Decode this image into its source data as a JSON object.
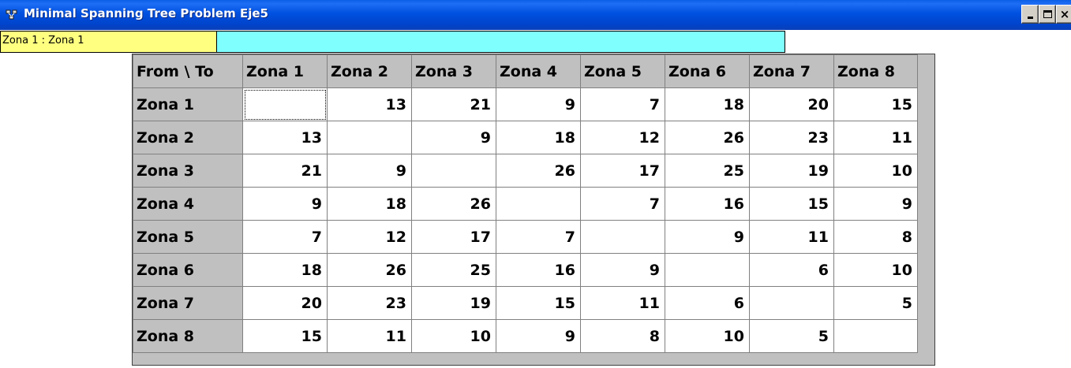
{
  "window": {
    "title": "Minimal Spanning Tree Problem Eje5",
    "icon": "app-network-icon",
    "controls": {
      "minimize": "minimize-icon",
      "maximize": "maximize-icon",
      "close": "×"
    }
  },
  "status": {
    "cell_label": "Zona 1 : Zona 1",
    "edit_value": ""
  },
  "grid": {
    "corner": "From \\ To",
    "columns": [
      "Zona 1",
      "Zona 2",
      "Zona 3",
      "Zona 4",
      "Zona 5",
      "Zona 6",
      "Zona 7",
      "Zona 8"
    ],
    "rows": [
      {
        "label": "Zona 1",
        "cells": [
          "",
          "13",
          "21",
          "9",
          "7",
          "18",
          "20",
          "15"
        ]
      },
      {
        "label": "Zona 2",
        "cells": [
          "13",
          "",
          "9",
          "18",
          "12",
          "26",
          "23",
          "11"
        ]
      },
      {
        "label": "Zona 3",
        "cells": [
          "21",
          "9",
          "",
          "26",
          "17",
          "25",
          "19",
          "10"
        ]
      },
      {
        "label": "Zona 4",
        "cells": [
          "9",
          "18",
          "26",
          "",
          "7",
          "16",
          "15",
          "9"
        ]
      },
      {
        "label": "Zona 5",
        "cells": [
          "7",
          "12",
          "17",
          "7",
          "",
          "9",
          "11",
          "8"
        ]
      },
      {
        "label": "Zona 6",
        "cells": [
          "18",
          "26",
          "25",
          "16",
          "9",
          "",
          "6",
          "10"
        ]
      },
      {
        "label": "Zona 7",
        "cells": [
          "20",
          "23",
          "19",
          "15",
          "11",
          "6",
          "",
          "5"
        ]
      },
      {
        "label": "Zona 8",
        "cells": [
          "15",
          "11",
          "10",
          "9",
          "8",
          "10",
          "5",
          ""
        ]
      }
    ],
    "active_cell": {
      "row": 0,
      "col": 0
    }
  },
  "colors": {
    "titlebar": "#0050e0",
    "status_left_bg": "#ffff80",
    "status_right_bg": "#80ffff",
    "header_bg": "#c0c0c0",
    "cell_bg": "#ffffff"
  }
}
